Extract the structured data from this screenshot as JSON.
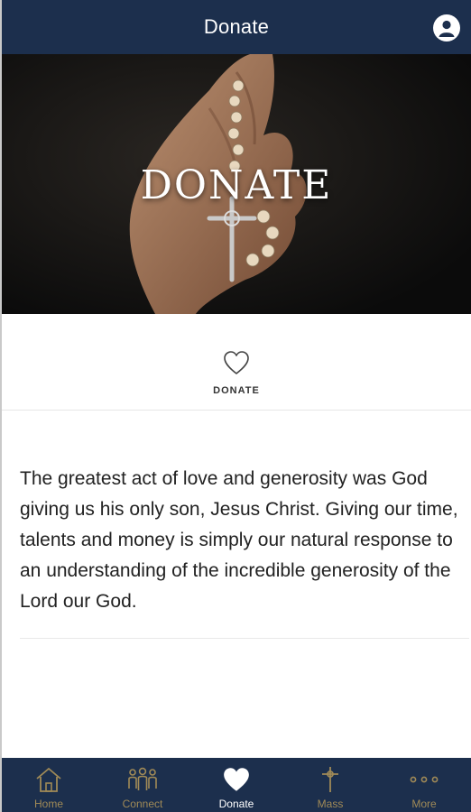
{
  "header": {
    "title": "Donate",
    "profile_icon": "user-circle-icon"
  },
  "hero": {
    "title": "DONATE"
  },
  "quick_link": {
    "label": "DONATE",
    "icon": "heart-outline-icon"
  },
  "content": {
    "paragraph": "The greatest act of love and generosity was God giving us his only son, Jesus Christ. Giving our time, talents and money is simply our natural response to an understanding of the incredible generosity of the Lord our God."
  },
  "tabbar": {
    "items": [
      {
        "label": "Home",
        "icon": "home-icon",
        "active": false
      },
      {
        "label": "Connect",
        "icon": "people-icon",
        "active": false
      },
      {
        "label": "Donate",
        "icon": "heart-icon",
        "active": true
      },
      {
        "label": "Mass",
        "icon": "cross-icon",
        "active": false
      },
      {
        "label": "More",
        "icon": "more-dots-icon",
        "active": false
      }
    ]
  },
  "colors": {
    "navy": "#1c2f4d",
    "gold": "#a08a57",
    "white": "#ffffff"
  }
}
